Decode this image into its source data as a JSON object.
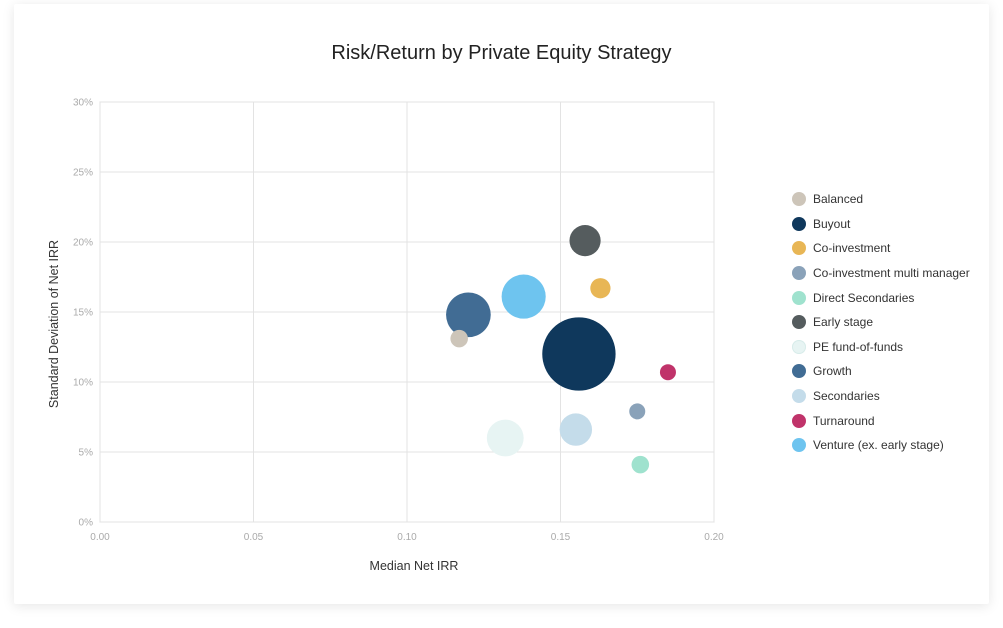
{
  "chart_data": {
    "type": "bubble",
    "title": "Risk/Return by Private Equity Strategy",
    "xlabel": "Median Net IRR",
    "ylabel": "Standard Deviation of Net IRR",
    "xlim": [
      0,
      0.2
    ],
    "ylim": [
      0,
      30
    ],
    "xticks": [
      "0.00",
      "0.05",
      "0.10",
      "0.15",
      "0.20"
    ],
    "yticks": [
      "0%",
      "5%",
      "10%",
      "15%",
      "20%",
      "25%",
      "30%"
    ],
    "grid": true,
    "legend_position": "right",
    "series": [
      {
        "name": "Balanced",
        "x": 0.117,
        "y": 13.1,
        "size": 1.2,
        "color": "#cdc5b9"
      },
      {
        "name": "Buyout",
        "x": 0.156,
        "y": 12.0,
        "size": 21.0,
        "color": "#0f385c"
      },
      {
        "name": "Co-investment",
        "x": 0.163,
        "y": 16.7,
        "size": 1.6,
        "color": "#e8b655"
      },
      {
        "name": "Co-investment multi manager",
        "x": 0.175,
        "y": 7.9,
        "size": 1.0,
        "color": "#8aa2b9"
      },
      {
        "name": "Direct Secondaries",
        "x": 0.176,
        "y": 4.1,
        "size": 1.2,
        "color": "#9fe2ce"
      },
      {
        "name": "Early stage",
        "x": 0.158,
        "y": 20.1,
        "size": 3.8,
        "color": "#555c5e"
      },
      {
        "name": "PE fund-of-funds",
        "x": 0.132,
        "y": 6.0,
        "size": 5.3,
        "color": "#e7f4f3"
      },
      {
        "name": "Growth",
        "x": 0.12,
        "y": 14.8,
        "size": 7.8,
        "color": "#416c94"
      },
      {
        "name": "Secondaries",
        "x": 0.155,
        "y": 6.6,
        "size": 4.1,
        "color": "#c4dcea"
      },
      {
        "name": "Turnaround",
        "x": 0.185,
        "y": 10.7,
        "size": 1.0,
        "color": "#c0336a"
      },
      {
        "name": "Venture (ex. early stage)",
        "x": 0.138,
        "y": 16.1,
        "size": 7.6,
        "color": "#6ec4ef"
      }
    ]
  }
}
